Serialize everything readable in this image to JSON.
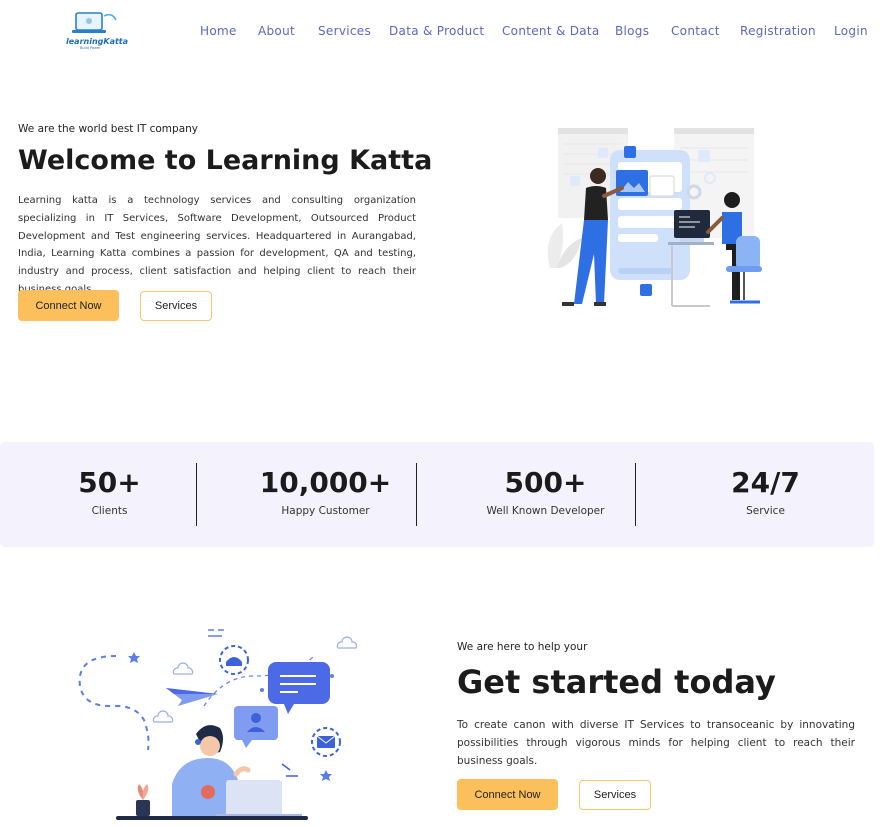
{
  "brand": {
    "logo_text": "learningKatta",
    "logo_sub": "Build Power"
  },
  "nav": {
    "items": [
      "Home",
      "About",
      "Services",
      "Data & Product",
      "Content & Data",
      "Blogs",
      "Contact",
      "Registration",
      "Login"
    ]
  },
  "hero": {
    "kicker": "We are the world best IT company",
    "title": "Welcome to Learning Katta",
    "description": "Learning katta is a technology services and consulting organization specializing in IT Services, Software Development, Outsourced Product Development and Test engineering services. Headquartered in Aurangabad, India, Learning Katta combines a passion for development, QA and testing, industry and process, client satisfaction and helping client to reach their business goals.",
    "primary_button": "Connect Now",
    "secondary_button": "Services"
  },
  "stats": [
    {
      "value": "50+",
      "label": "Clients"
    },
    {
      "value": "10,000+",
      "label": "Happy Customer"
    },
    {
      "value": "500+",
      "label": "Well Known Developer"
    },
    {
      "value": "24/7",
      "label": "Service"
    }
  ],
  "get_started": {
    "kicker": "We are here to help your",
    "title": "Get started today",
    "description": "To create canon with diverse IT Services to transoceanic by innovating possibilities through vigorous minds for helping client to reach their business goals.",
    "primary_button": "Connect Now",
    "secondary_button": "Services"
  },
  "colors": {
    "accent": "#fbc05b",
    "nav_link": "#5b68c0",
    "stats_bg": "#f3f2fd",
    "illustration_blue": "#2f6fe4"
  }
}
